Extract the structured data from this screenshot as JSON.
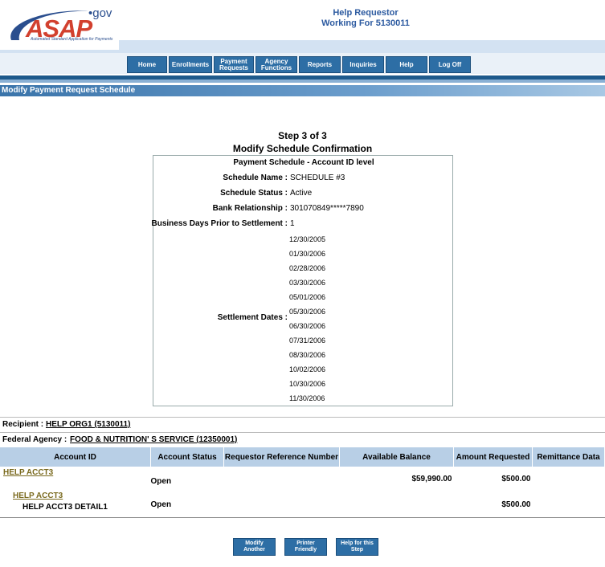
{
  "brand": {
    "logo": "ASAP",
    "gov": "•gov",
    "tagline": "Automated Standard Application for Payments"
  },
  "user": {
    "role": "Help Requestor",
    "working_for": "Working For 5130011"
  },
  "nav": [
    {
      "label": "Home"
    },
    {
      "label": "Enrollments"
    },
    {
      "label": "Payment\nRequests"
    },
    {
      "label": "Agency\nFunctions"
    },
    {
      "label": "Reports"
    },
    {
      "label": "Inquiries"
    },
    {
      "label": "Help"
    },
    {
      "label": "Log Off"
    }
  ],
  "page_title": "Modify Payment Request Schedule",
  "step": {
    "line1": "Step 3 of 3",
    "line2": "Modify Schedule Confirmation"
  },
  "summary": {
    "heading": "Payment Schedule - Account ID level",
    "schedule_name_label": "Schedule Name :",
    "schedule_name": "SCHEDULE #3",
    "schedule_status_label": "Schedule Status :",
    "schedule_status": "Active",
    "bank_label": "Bank Relationship :",
    "bank": "301070849*****7890",
    "bdays_label": "Business Days Prior to Settlement :",
    "bdays": "1",
    "dates_label": "Settlement Dates :",
    "dates": [
      "12/30/2005",
      "01/30/2006",
      "02/28/2006",
      "03/30/2006",
      "05/01/2006",
      "05/30/2006",
      "06/30/2006",
      "07/31/2006",
      "08/30/2006",
      "10/02/2006",
      "10/30/2006",
      "11/30/2006"
    ]
  },
  "recipient": {
    "label": "Recipient :",
    "value": "HELP ORG1 (5130011)"
  },
  "agency": {
    "label": "Federal Agency :",
    "value": "FOOD & NUTRITION' S SERVICE (12350001)"
  },
  "table": {
    "headers": [
      "Account ID",
      "Account Status",
      "Requestor Reference Number",
      "Available Balance",
      "Amount Requested",
      "Remittance Data"
    ],
    "rows": [
      {
        "account": "HELP ACCT3",
        "status": "Open",
        "balance": "$59,990.00",
        "amount": "$500.00"
      },
      {
        "account": "HELP ACCT3",
        "detail": "HELP ACCT3 DETAIL1",
        "status": "Open",
        "balance": "",
        "amount": "$500.00"
      }
    ]
  },
  "buttons": {
    "modify": "Modify\nAnother",
    "printer": "Printer\nFriendly",
    "help": "Help for this\nStep"
  }
}
